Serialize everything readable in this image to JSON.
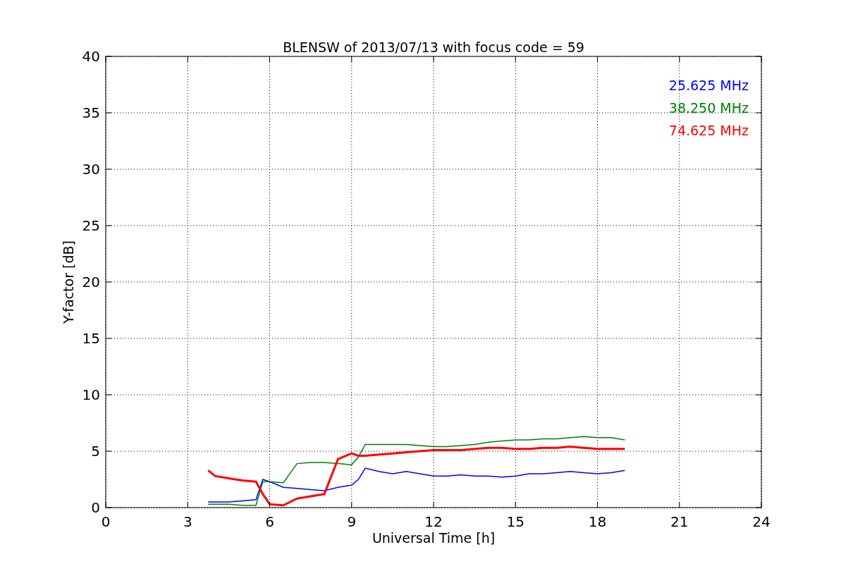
{
  "figure": {
    "chart_data": {
      "type": "line",
      "title": "BLENSW of 2013/07/13 with focus code = 59",
      "xlabel": "Universal Time [h]",
      "ylabel": "Y-factor [dB]",
      "x": [
        3.75,
        4,
        4.5,
        5,
        5.5,
        5.75,
        6,
        6.5,
        7,
        7.5,
        8,
        8.5,
        9,
        9.25,
        9.5,
        10,
        10.5,
        11,
        11.5,
        12,
        12.5,
        13,
        13.5,
        14,
        14.5,
        15,
        15.5,
        16,
        16.5,
        17,
        17.5,
        18,
        18.5,
        19
      ],
      "series": [
        {
          "name": "25.625 MHz",
          "color": "#0000ff",
          "values": [
            0.5,
            0.5,
            0.5,
            0.6,
            0.7,
            2.5,
            2.3,
            1.8,
            1.7,
            1.6,
            1.5,
            1.8,
            2.0,
            2.5,
            3.5,
            3.2,
            3.0,
            3.2,
            3.0,
            2.8,
            2.8,
            2.9,
            2.8,
            2.8,
            2.7,
            2.8,
            3.0,
            3.0,
            3.1,
            3.2,
            3.1,
            3.0,
            3.1,
            3.3
          ]
        },
        {
          "name": "38.250 MHz",
          "color": "#008000",
          "values": [
            0.3,
            0.3,
            0.3,
            0.2,
            0.2,
            2.3,
            2.3,
            2.2,
            3.9,
            4.0,
            4.0,
            3.9,
            3.8,
            4.5,
            5.6,
            5.6,
            5.6,
            5.6,
            5.5,
            5.4,
            5.4,
            5.5,
            5.6,
            5.8,
            5.9,
            6.0,
            6.0,
            6.1,
            6.1,
            6.2,
            6.3,
            6.2,
            6.2,
            6.0
          ]
        },
        {
          "name": "74.625 MHz",
          "color": "#ff0000",
          "values": [
            3.3,
            2.8,
            2.6,
            2.4,
            2.3,
            1.2,
            0.3,
            0.2,
            0.8,
            1.0,
            1.2,
            4.3,
            4.8,
            4.6,
            4.6,
            4.7,
            4.8,
            4.9,
            5.0,
            5.1,
            5.1,
            5.1,
            5.2,
            5.3,
            5.3,
            5.2,
            5.2,
            5.3,
            5.3,
            5.4,
            5.3,
            5.2,
            5.2,
            5.2
          ]
        }
      ],
      "grid": true,
      "xlim": [
        0,
        24
      ],
      "ylim": [
        0,
        40
      ],
      "xticks": [
        0,
        3,
        6,
        9,
        12,
        15,
        18,
        21,
        24
      ],
      "yticks": [
        0,
        5,
        10,
        15,
        20,
        25,
        30,
        35,
        40
      ]
    }
  }
}
